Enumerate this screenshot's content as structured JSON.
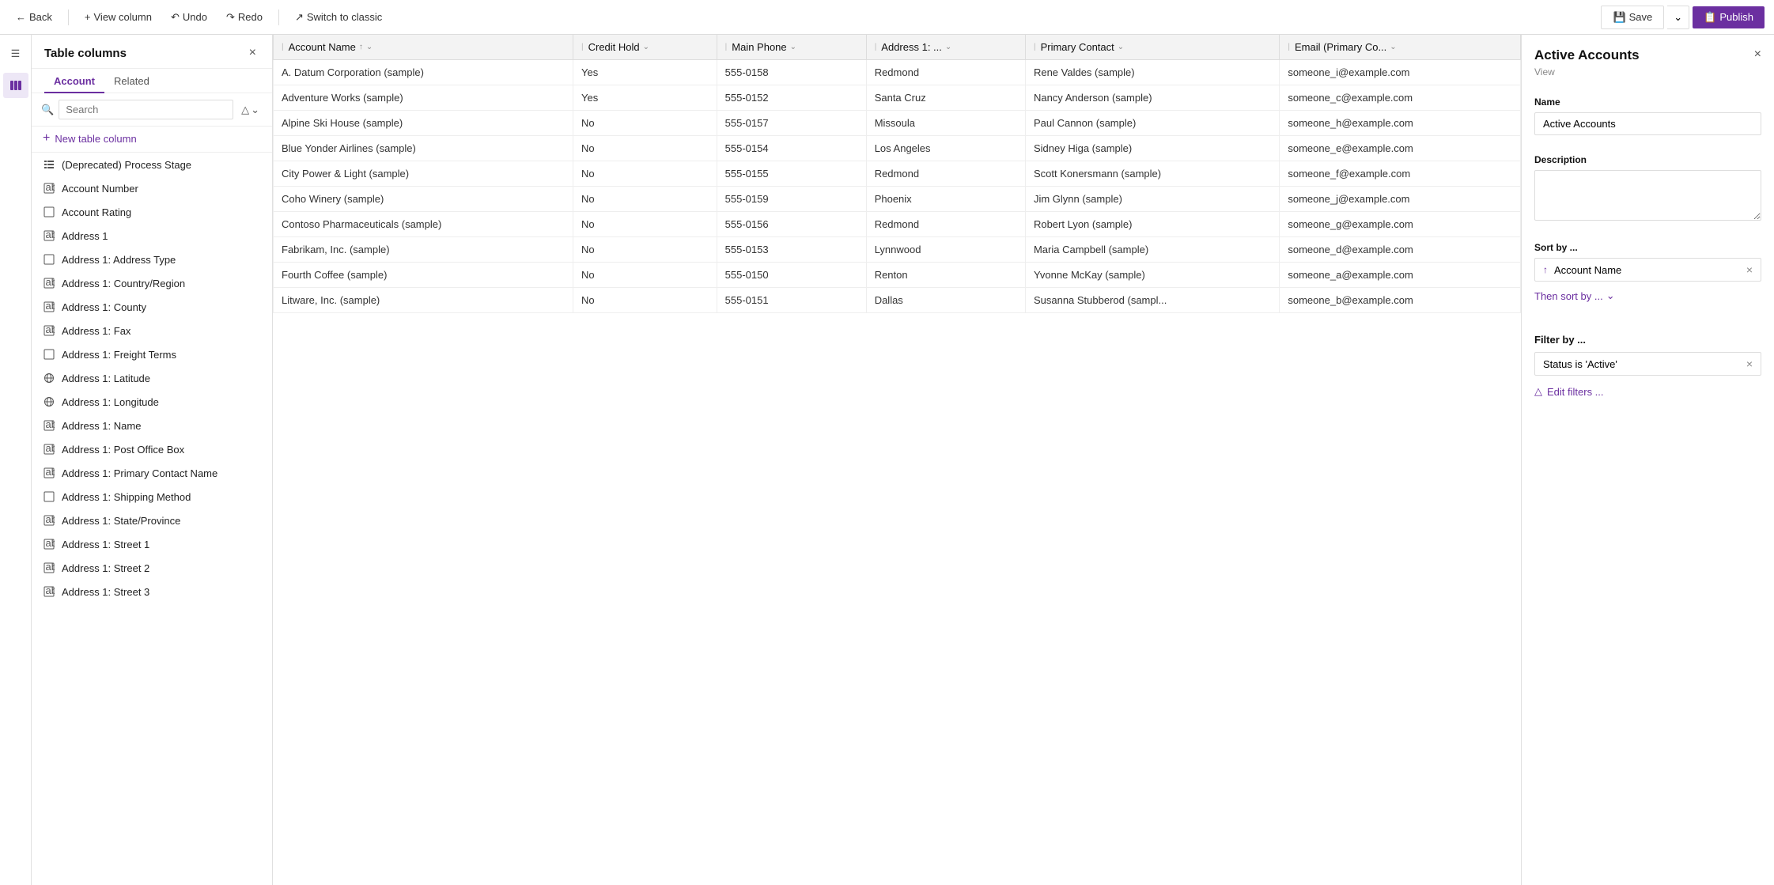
{
  "topbar": {
    "back_label": "Back",
    "view_column_label": "View column",
    "undo_label": "Undo",
    "redo_label": "Redo",
    "switch_label": "Switch to classic",
    "save_label": "Save",
    "publish_label": "Publish"
  },
  "sidebar": {
    "title": "Table columns",
    "close_label": "×",
    "tabs": [
      {
        "label": "Account",
        "active": true
      },
      {
        "label": "Related",
        "active": false
      }
    ],
    "search_placeholder": "Search",
    "new_column_label": "New table column",
    "items": [
      {
        "label": "(Deprecated) Process Stage",
        "icon": "list"
      },
      {
        "label": "Account Number",
        "icon": "abc"
      },
      {
        "label": "Account Rating",
        "icon": "box"
      },
      {
        "label": "Address 1",
        "icon": "abc"
      },
      {
        "label": "Address 1: Address Type",
        "icon": "box"
      },
      {
        "label": "Address 1: Country/Region",
        "icon": "abc"
      },
      {
        "label": "Address 1: County",
        "icon": "abc"
      },
      {
        "label": "Address 1: Fax",
        "icon": "abc"
      },
      {
        "label": "Address 1: Freight Terms",
        "icon": "box"
      },
      {
        "label": "Address 1: Latitude",
        "icon": "globe"
      },
      {
        "label": "Address 1: Longitude",
        "icon": "globe"
      },
      {
        "label": "Address 1: Name",
        "icon": "abc"
      },
      {
        "label": "Address 1: Post Office Box",
        "icon": "abc"
      },
      {
        "label": "Address 1: Primary Contact Name",
        "icon": "abc"
      },
      {
        "label": "Address 1: Shipping Method",
        "icon": "box"
      },
      {
        "label": "Address 1: State/Province",
        "icon": "abc"
      },
      {
        "label": "Address 1: Street 1",
        "icon": "abc"
      },
      {
        "label": "Address 1: Street 2",
        "icon": "abc"
      },
      {
        "label": "Address 1: Street 3",
        "icon": "abc"
      }
    ]
  },
  "grid": {
    "columns": [
      {
        "label": "Account Name",
        "sortable": true,
        "sort": "asc"
      },
      {
        "label": "Credit Hold",
        "sortable": true
      },
      {
        "label": "Main Phone",
        "sortable": true
      },
      {
        "label": "Address 1: ...",
        "sortable": true
      },
      {
        "label": "Primary Contact",
        "sortable": true
      },
      {
        "label": "Email (Primary Co...",
        "sortable": true
      }
    ],
    "rows": [
      [
        "A. Datum Corporation (sample)",
        "Yes",
        "555-0158",
        "Redmond",
        "Rene Valdes (sample)",
        "someone_i@example.com"
      ],
      [
        "Adventure Works (sample)",
        "Yes",
        "555-0152",
        "Santa Cruz",
        "Nancy Anderson (sample)",
        "someone_c@example.com"
      ],
      [
        "Alpine Ski House (sample)",
        "No",
        "555-0157",
        "Missoula",
        "Paul Cannon (sample)",
        "someone_h@example.com"
      ],
      [
        "Blue Yonder Airlines (sample)",
        "No",
        "555-0154",
        "Los Angeles",
        "Sidney Higa (sample)",
        "someone_e@example.com"
      ],
      [
        "City Power & Light (sample)",
        "No",
        "555-0155",
        "Redmond",
        "Scott Konersmann (sample)",
        "someone_f@example.com"
      ],
      [
        "Coho Winery (sample)",
        "No",
        "555-0159",
        "Phoenix",
        "Jim Glynn (sample)",
        "someone_j@example.com"
      ],
      [
        "Contoso Pharmaceuticals (sample)",
        "No",
        "555-0156",
        "Redmond",
        "Robert Lyon (sample)",
        "someone_g@example.com"
      ],
      [
        "Fabrikam, Inc. (sample)",
        "No",
        "555-0153",
        "Lynnwood",
        "Maria Campbell (sample)",
        "someone_d@example.com"
      ],
      [
        "Fourth Coffee (sample)",
        "No",
        "555-0150",
        "Renton",
        "Yvonne McKay (sample)",
        "someone_a@example.com"
      ],
      [
        "Litware, Inc. (sample)",
        "No",
        "555-0151",
        "Dallas",
        "Susanna Stubberod (sampl...",
        "someone_b@example.com"
      ]
    ]
  },
  "right_panel": {
    "title": "Active Accounts",
    "subtitle": "View",
    "close_label": "×",
    "name_label": "Name",
    "name_value": "Active Accounts",
    "description_label": "Description",
    "description_placeholder": "",
    "sort_label": "Sort by ...",
    "sort_field": "Account Name",
    "sort_remove_label": "×",
    "then_sort_label": "Then sort by ...",
    "filter_label": "Filter by ...",
    "filter_value": "Status is 'Active'",
    "filter_remove_label": "×",
    "edit_filters_label": "Edit filters ..."
  }
}
